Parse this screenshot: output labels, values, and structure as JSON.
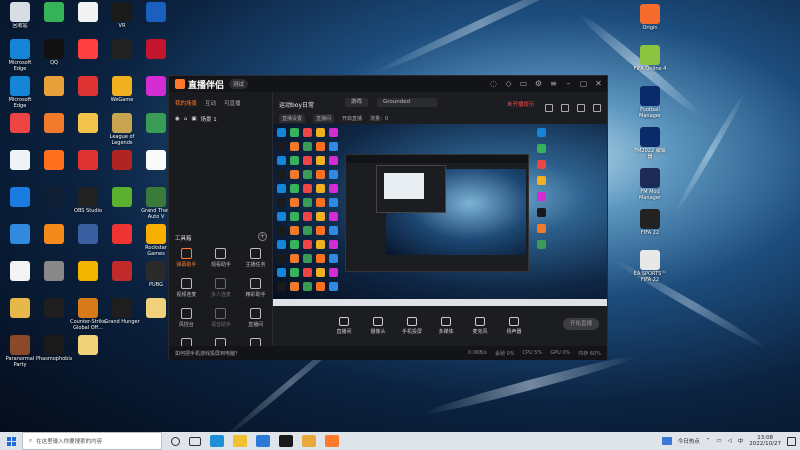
{
  "desktop": {
    "left_icons": [
      {
        "label": "回收站",
        "color": "#d8dde3"
      },
      {
        "label": "",
        "color": "#36b35a"
      },
      {
        "label": "",
        "color": "#f2f2f2"
      },
      {
        "label": "VR",
        "color": "#1a1a1a"
      },
      {
        "label": "",
        "color": "#1b5fbf"
      },
      {
        "label": "Microsoft Edge",
        "color": "#1585d8"
      },
      {
        "label": "QQ",
        "color": "#111"
      },
      {
        "label": "",
        "color": "#ff4040"
      },
      {
        "label": "",
        "color": "#222"
      },
      {
        "label": "",
        "color": "#c3162e"
      },
      {
        "label": "Microsoft Edge",
        "color": "#1585d8"
      },
      {
        "label": "",
        "color": "#e8a03a"
      },
      {
        "label": "",
        "color": "#d33"
      },
      {
        "label": "WeGame",
        "color": "#f0b020"
      },
      {
        "label": "",
        "color": "#d22cd2"
      },
      {
        "label": "",
        "color": "#e44"
      },
      {
        "label": "",
        "color": "#f07a2a"
      },
      {
        "label": "",
        "color": "#f3c24a"
      },
      {
        "label": "League of Legends",
        "color": "#c8a450"
      },
      {
        "label": "",
        "color": "#3a9b54"
      },
      {
        "label": "",
        "color": "#f0f4f8"
      },
      {
        "label": "",
        "color": "#ff6f1e"
      },
      {
        "label": "",
        "color": "#d33"
      },
      {
        "label": "",
        "color": "#b02424"
      },
      {
        "label": "",
        "color": "#fafafa"
      },
      {
        "label": "",
        "color": "#1a7be0"
      },
      {
        "label": "",
        "color": "#0f1e33"
      },
      {
        "label": "OBS Studio",
        "color": "#222"
      },
      {
        "label": "",
        "color": "#5cb030"
      },
      {
        "label": "Grand Theft Auto V",
        "color": "#3a7a3a"
      },
      {
        "label": "",
        "color": "#2f8ae0"
      },
      {
        "label": "",
        "color": "#f48a1a"
      },
      {
        "label": "",
        "color": "#3a5fa0"
      },
      {
        "label": "",
        "color": "#e33"
      },
      {
        "label": "Rockstar Games",
        "color": "#f8b000"
      },
      {
        "label": "",
        "color": "#f4f4f4"
      },
      {
        "label": "",
        "color": "#888"
      },
      {
        "label": "",
        "color": "#f3b400"
      },
      {
        "label": "",
        "color": "#c02a2a"
      },
      {
        "label": "PUBG",
        "color": "#2a2a2a"
      },
      {
        "label": "",
        "color": "#e6b84a"
      },
      {
        "label": "",
        "color": "#1e1e1e"
      },
      {
        "label": "Counter-Strike Global Off...",
        "color": "#d77a1a"
      },
      {
        "label": "Grand Hunger",
        "color": "#1e1e1e"
      },
      {
        "label": "",
        "color": "#f0d27a"
      },
      {
        "label": "Paranormal Party",
        "color": "#8a4a2a"
      },
      {
        "label": "Phasmophobia",
        "color": "#1a1a1a"
      },
      {
        "label": "",
        "color": "#f0d27a"
      }
    ],
    "right_icons": [
      {
        "label": "Origin",
        "color": "#f56c2d"
      },
      {
        "label": "FIFA Online 4",
        "color": "#8bc540"
      },
      {
        "label": "Football Manager 2022",
        "color": "#0a2a6a"
      },
      {
        "label": "FM2022 编辑器",
        "color": "#0a2a6a"
      },
      {
        "label": "FM Mod Manager",
        "color": "#1d2a55"
      },
      {
        "label": "FIFA 22",
        "color": "#222"
      },
      {
        "label": "EA SPORTS™ FIFA 22",
        "color": "#e8e8e8"
      }
    ]
  },
  "app": {
    "title": "直播伴侣",
    "version_badge": "测试",
    "left_tabs": [
      "我的场景",
      "互动",
      "可直播"
    ],
    "scene_name": "场景 1",
    "tools_header": "工具箱",
    "tools": [
      {
        "label": "弹幕助手",
        "orange": true
      },
      {
        "label": "观看助手",
        "orange": false
      },
      {
        "label": "主播任务",
        "orange": false
      },
      {
        "label": "视频连麦",
        "orange": false
      },
      {
        "label": "多人连麦",
        "orange": false,
        "dim": true
      },
      {
        "label": "精彩助手",
        "orange": false
      },
      {
        "label": "风控台",
        "orange": false
      },
      {
        "label": "语音助手",
        "orange": false,
        "dim": true
      },
      {
        "label": "直播间",
        "orange": false
      },
      {
        "label": "直播助手",
        "orange": false
      },
      {
        "label": "",
        "orange": false
      },
      {
        "label": "",
        "orange": false
      }
    ],
    "scene_title": "运动boy日常",
    "pill1": "游戏",
    "pill2": "Grounded",
    "red_notice": "未开播提示",
    "row2": [
      "直播设置",
      "直播间",
      "开启直播",
      "流量：0"
    ],
    "controls": [
      "直播间",
      "摄像头",
      "手机投屏",
      "多媒体",
      "麦克风",
      "扬声器"
    ],
    "live_button": "开始直播",
    "status_left": "如何把手机游戏投屏到电脑？",
    "status_right": [
      "0.0KB/s",
      "丢帧 0%",
      "CPU 5%",
      "GPU 0%",
      "内存 60%"
    ]
  },
  "taskbar": {
    "search_placeholder": "在这里输入你要搜索的内容",
    "weather": "今日热点",
    "time": "13:08",
    "date": "2022/10/27"
  }
}
